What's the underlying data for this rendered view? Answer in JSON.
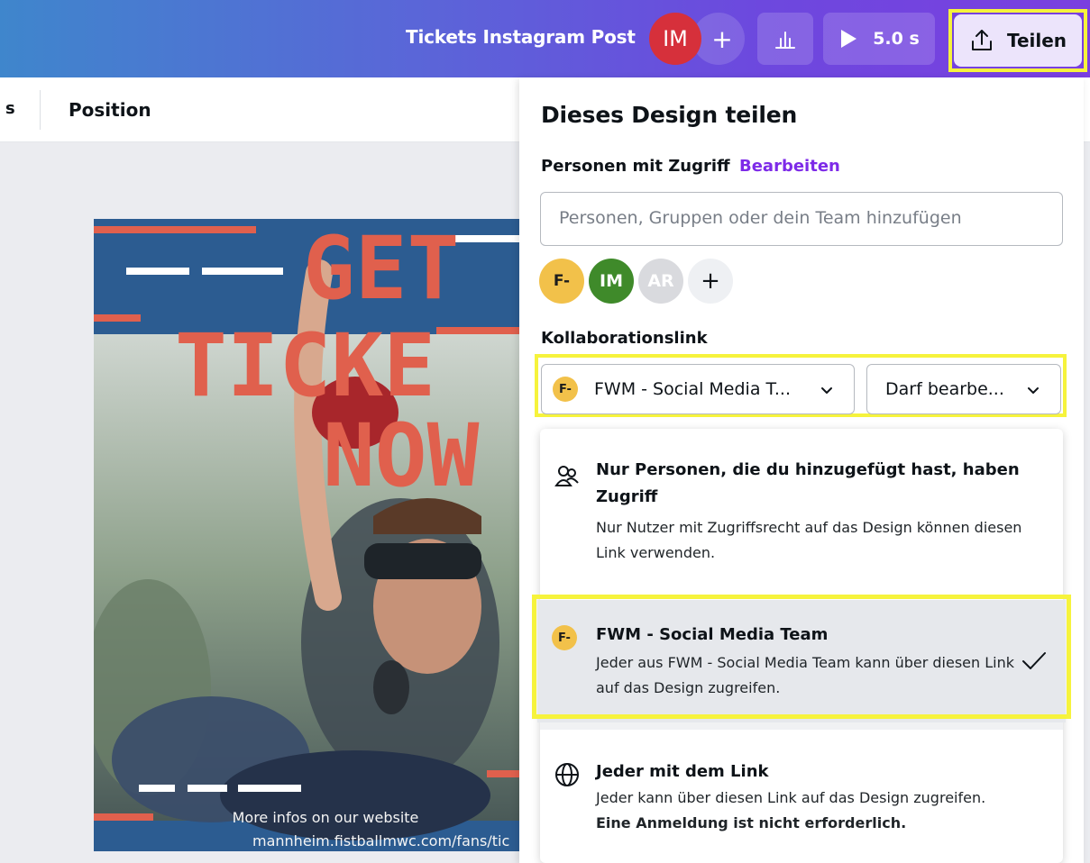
{
  "topbar": {
    "design_title": "Tickets Instagram Post",
    "user_initials": "IM",
    "add_people_icon": "+",
    "insights_icon": "bar-chart-icon",
    "play_duration": "5.0 s",
    "share_label": "Teilen",
    "brand_gradient": [
      "#3f86cc",
      "#7a3fe0"
    ]
  },
  "toolbar": {
    "fragment_label": "s",
    "position_label": "Position"
  },
  "poster": {
    "headline_lines": [
      "GET",
      "TICKE",
      "NOW"
    ],
    "info_line": "More infos on our website",
    "url_line": "mannheim.fistballmwc.com/fans/tic"
  },
  "share_panel": {
    "title": "Dieses Design teilen",
    "access_label": "Personen mit Zugriff",
    "access_edit": "Bearbeiten",
    "search_placeholder": "Personen, Gruppen oder dein Team hinzufügen",
    "avatars": [
      "F-",
      "IM",
      "AR",
      "+"
    ],
    "collab_label": "Kollaborationslink",
    "team_select": "FWM - Social Media T...",
    "team_initials": "F-",
    "permission_select": "Darf bearbe..."
  },
  "link_options": [
    {
      "title": "Nur Personen, die du hinzugefügt hast, haben Zugriff",
      "desc": "Nur Nutzer mit Zugriffsrecht auf das Design können diesen Link verwenden.",
      "icon": "people-icon"
    },
    {
      "title": "FWM - Social Media Team",
      "desc": "Jeder aus FWM - Social Media Team kann über diesen Link auf das Design zugreifen.",
      "initials": "F-",
      "selected": true
    },
    {
      "title": "Jeder mit dem Link",
      "desc": "Jeder kann über diesen Link auf das Design zugreifen.",
      "desc_bold": "Eine Anmeldung ist nicht erforderlich.",
      "icon": "globe-icon"
    }
  ],
  "colors": {
    "accent_purple": "#7d2ae8",
    "highlight_yellow": "#f6f33c",
    "avatar_red": "#d6303b",
    "avatar_green": "#3f8a2a",
    "team_yellow": "#f2c14a",
    "poster_blue": "#2c5c91",
    "poster_coral": "#e0604d"
  }
}
